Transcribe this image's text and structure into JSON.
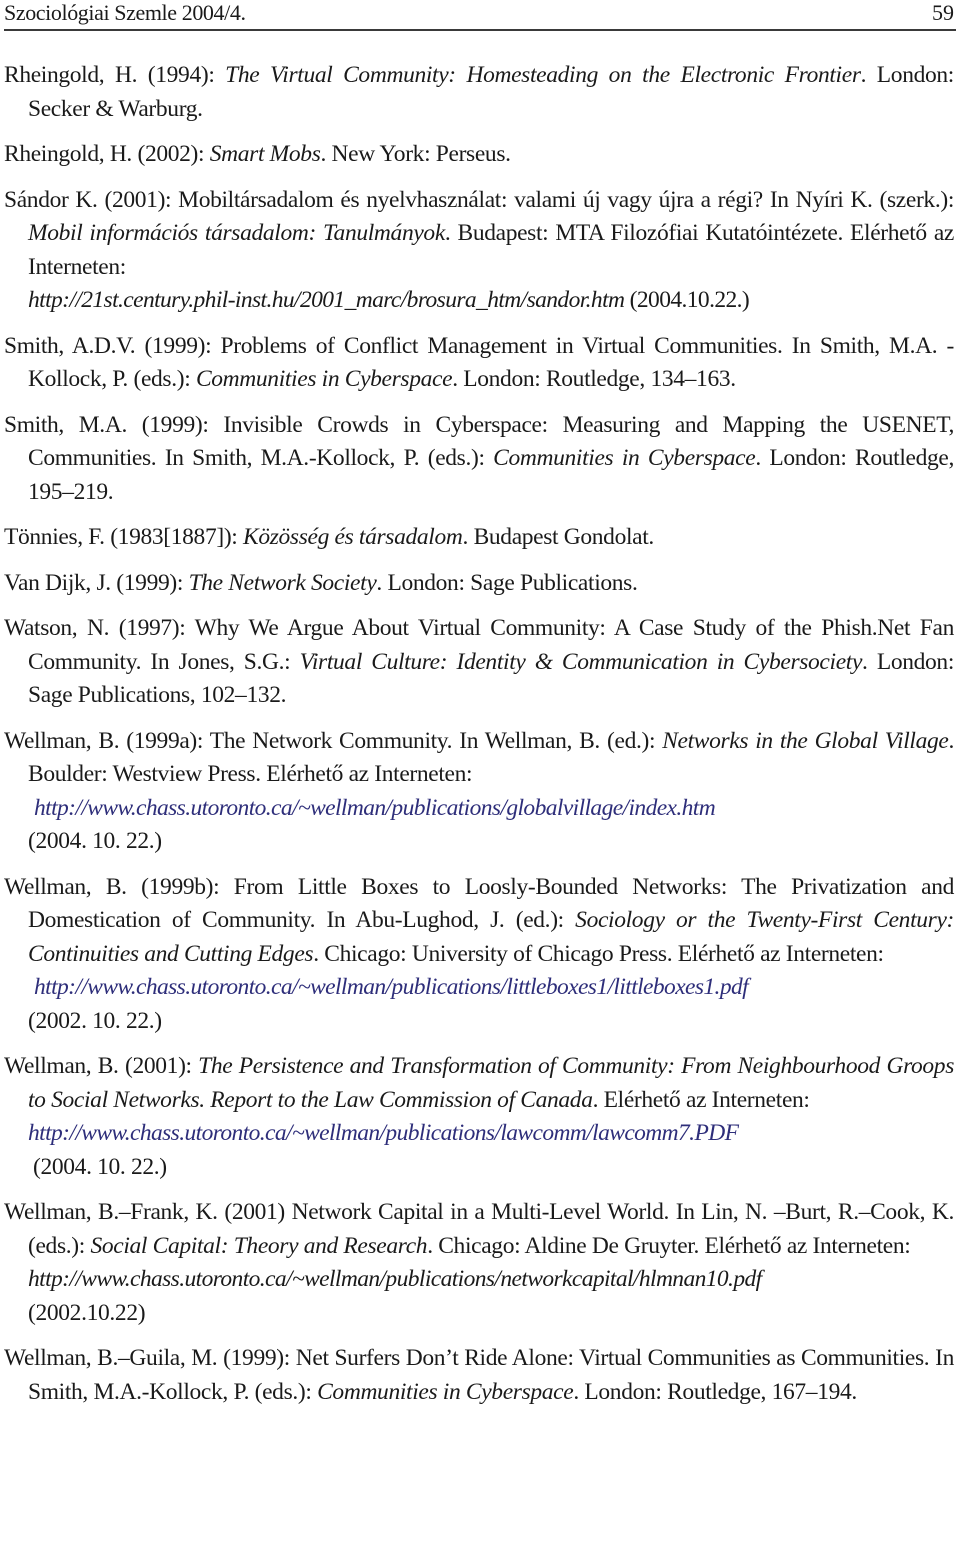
{
  "header": {
    "journal": "Szociológiai Szemle 2004/4.",
    "page_number": "59"
  },
  "colors": {
    "link": "#2e2e7a",
    "text": "#1a1a1a",
    "rule": "#3a3a3a"
  },
  "references": [
    {
      "pre": "Rheingold, H. (1994): ",
      "title": "The Virtual Community: Homesteading on the Electronic Frontier",
      "post": ". London: Secker & Warburg."
    },
    {
      "pre": "Rheingold, H. (2002): ",
      "title": "Smart Mobs",
      "post": ". New York: Perseus."
    },
    {
      "pre": "Sándor K. (2001): Mobiltársadalom és nyelvhasználat: valami új vagy újra a régi? In Nyíri K. (szerk.): ",
      "title": "Mobil információs társadalom: Tanulmányok",
      "post": ". Budapest: MTA Filozófiai Kutatóintézete. Elérhető az Interneten:",
      "url": "http://21st.century.phil-inst.hu/2001_marc/brosura_htm/sandor.htm",
      "date": " (2004.10.22.)"
    },
    {
      "pre": "Smith, A.D.V. (1999): Problems of Conflict Management in Virtual Communities. In Smith, M.A. -Kollock, P. (eds.): ",
      "title": "Communities in Cyberspace",
      "post": ". London: Routledge, 134–163."
    },
    {
      "pre": "Smith, M.A. (1999): Invisible Crowds in Cyberspace: Measuring and Mapping the USENET, Communities. In Smith, M.A.-Kollock, P. (eds.): ",
      "title": "Communities in Cyberspace",
      "post": ". London: Routledge, 195–219."
    },
    {
      "pre": "Tönnies, F. (1983[1887]): ",
      "title": "Közösség és társadalom",
      "post": ". Budapest Gondolat."
    },
    {
      "pre": "Van Dijk, J. (1999): ",
      "title": "The Network Society",
      "post": ". London: Sage Publications."
    },
    {
      "pre": "Watson, N. (1997): Why We Argue About Virtual Community: A Case Study of the Phish.Net Fan Community. In Jones, S.G.: ",
      "title": "Virtual Culture: Identity & Communication in Cybersociety",
      "post": ". London: Sage Publications, 102–132."
    },
    {
      "pre": "Wellman, B. (1999a): The Network Community. In Wellman, B. (ed.): ",
      "title": "Networks in the Global Village",
      "post": ". Boulder: Westview Press. Elérhető az Interneten:",
      "url": "http://www.chass.utoronto.ca/~wellman/publications/globalvillage/index.htm",
      "date": "(2004. 10. 22.)"
    },
    {
      "pre": "Wellman, B. (1999b): From Little Boxes to Loosly-Bounded Networks: The Privatization and Domestication of Community. In Abu-Lughod, J. (ed.): ",
      "title": "Sociology or the Twenty-First Century: Continuities and Cutting Edges",
      "post": ". Chicago: University of Chicago Press. Elérhető az Interneten:",
      "url": "http://www.chass.utoronto.ca/~wellman/publications/littleboxes1/littleboxes1.pdf",
      "date": "(2002. 10. 22.)"
    },
    {
      "pre": "Wellman, B. (2001): ",
      "title": "The Persistence and Transformation of Community: From Neighbourhood Groops to Social Networks. Report to the Law Commission of Canada",
      "post": ". Elérhető az Interneten:",
      "url": "http://www.chass.utoronto.ca/~wellman/publications/lawcomm/lawcomm7.PDF",
      "date": "(2004. 10. 22.)"
    },
    {
      "pre": "Wellman, B.–Frank, K. (2001) Network Capital in a Multi-Level World. In Lin, N. –Burt, R.–Cook, K. (eds.): ",
      "title": "Social Capital: Theory and Research",
      "post": ". Chicago: Aldine De Gruyter. Elérhető az Interneten:",
      "url": "http://www.chass.utoronto.ca/~wellman/publications/networkcapital/hlmnan10.pdf",
      "date": "(2002.10.22)"
    },
    {
      "pre": "Wellman, B.–Guila, M. (1999): Net Surfers Don’t Ride Alone: Virtual Communities as Communities. In Smith, M.A.-Kollock, P. (eds.): ",
      "title": "Communities in Cyberspace",
      "post": ". London: Routledge, 167–194."
    }
  ]
}
